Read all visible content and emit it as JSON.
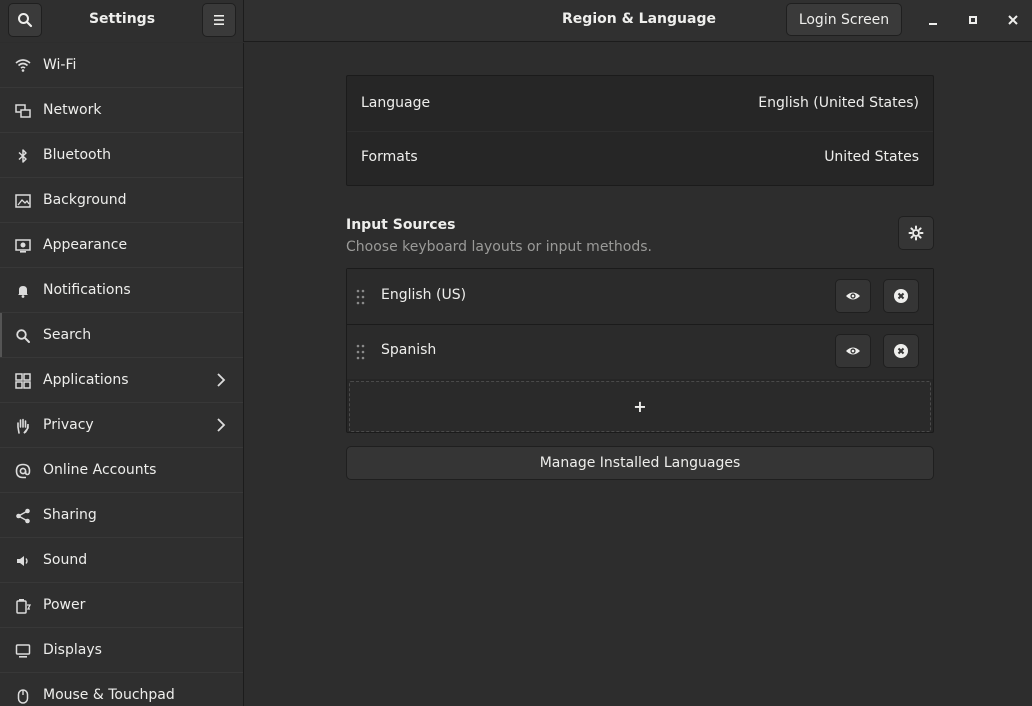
{
  "header": {
    "app_title": "Settings",
    "page_title": "Region & Language",
    "login_screen_label": "Login Screen"
  },
  "sidebar": {
    "items": [
      {
        "label": "Wi-Fi",
        "icon": "wifi-icon"
      },
      {
        "label": "Network",
        "icon": "network-icon"
      },
      {
        "label": "Bluetooth",
        "icon": "bluetooth-icon"
      },
      {
        "label": "Background",
        "icon": "background-icon"
      },
      {
        "label": "Appearance",
        "icon": "appearance-icon"
      },
      {
        "label": "Notifications",
        "icon": "bell-icon"
      },
      {
        "label": "Search",
        "icon": "search-icon"
      },
      {
        "label": "Applications",
        "icon": "grid-icon",
        "chevron": true
      },
      {
        "label": "Privacy",
        "icon": "hand-icon",
        "chevron": true
      },
      {
        "label": "Online Accounts",
        "icon": "at-icon"
      },
      {
        "label": "Sharing",
        "icon": "share-icon"
      },
      {
        "label": "Sound",
        "icon": "speaker-icon"
      },
      {
        "label": "Power",
        "icon": "power-icon"
      },
      {
        "label": "Displays",
        "icon": "display-icon"
      },
      {
        "label": "Mouse & Touchpad",
        "icon": "mouse-icon"
      }
    ]
  },
  "region": {
    "language_label": "Language",
    "language_value": "English (United States)",
    "formats_label": "Formats",
    "formats_value": "United States"
  },
  "input_sources": {
    "title": "Input Sources",
    "subtitle": "Choose keyboard layouts or input methods.",
    "sources": [
      {
        "name": "English (US)"
      },
      {
        "name": "Spanish"
      }
    ],
    "add_label": "+",
    "manage_label": "Manage Installed Languages"
  },
  "colors": {
    "background": "#2d2d2d",
    "sidebar": "#2f2f2f",
    "frame": "#262626",
    "text": "#eeeeec",
    "dim_text": "#9a9a98"
  }
}
